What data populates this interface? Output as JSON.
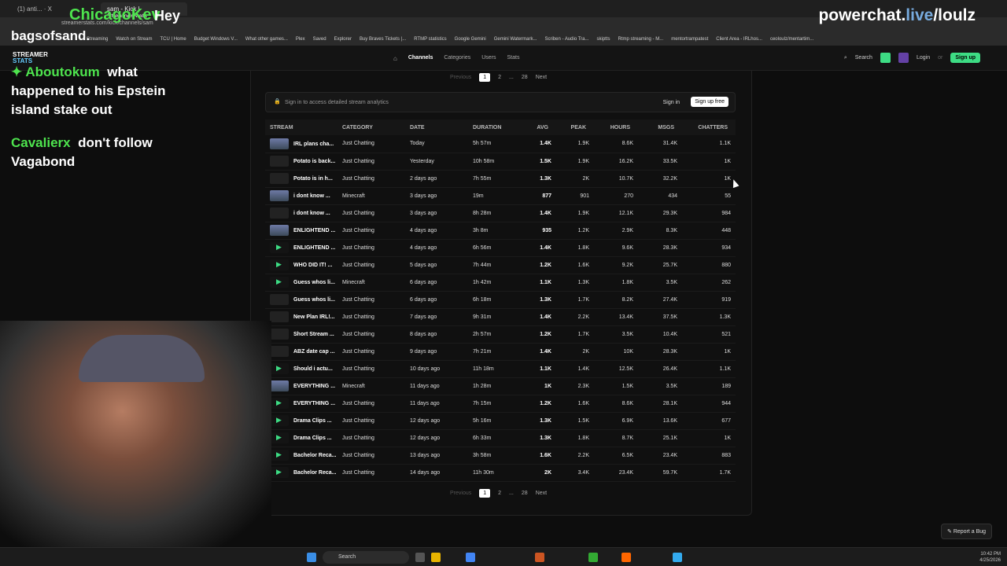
{
  "browser": {
    "tabs": [
      "(1) anti... · X",
      "sam - Kick | StreamerStats"
    ],
    "url": "streamerstats.com/kick/channels/sam",
    "bookmarks": [
      "Streaming",
      "Watch on Stream",
      "TCU | Home",
      "Budget Windows V...",
      "What other games...",
      "Plex",
      "Saved",
      "Explorer",
      "Buy Braves Tickets |...",
      "RTMP statistics",
      "Google Gemini",
      "Gemini Watermark...",
      "Scriben - Audio Tra...",
      "skiptts",
      "Rtmp streaming - M...",
      "mentortrampatest",
      "Client Area - IRLhos...",
      "ceoloulz/mentartim..."
    ]
  },
  "overlay": {
    "title": "ChicagoKev",
    "greet": "Hey",
    "name_line": "bagsofsand.",
    "powerchat_a": "powerchat.",
    "powerchat_b": "live",
    "powerchat_c": "/loulz",
    "chat": [
      {
        "user": "Aboutokum",
        "text1": "what",
        "text2": "happened to his Epstein",
        "text3": "island stake out"
      },
      {
        "user": "Cavalierx",
        "text1": "don't follow",
        "text2": "Vagabond"
      }
    ]
  },
  "site": {
    "logo_top": "STREAMER",
    "logo_bottom": "STATS",
    "nav": [
      "Channels",
      "Categories",
      "Users",
      "Stats"
    ],
    "search": "Search",
    "login": "Login",
    "or": "or",
    "signup": "Sign up"
  },
  "pager": {
    "prev": "Previous",
    "p1": "1",
    "p2": "2",
    "dots": "...",
    "last": "28",
    "next": "Next"
  },
  "signin_bar": {
    "text": "Sign in to access detailed stream analytics",
    "signin": "Sign in",
    "signup": "Sign up free"
  },
  "table": {
    "headers": [
      "STREAM",
      "CATEGORY",
      "DATE",
      "DURATION",
      "AVG",
      "PEAK",
      "HOURS",
      "MSGS",
      "CHATTERS"
    ],
    "rows": [
      {
        "thumb": "img",
        "stream": "IRL plans cha...",
        "category": "Just Chatting",
        "date": "Today",
        "duration": "5h 57m",
        "avg": "1.4K",
        "peak": "1.9K",
        "hours": "8.6K",
        "msgs": "31.4K",
        "chatters": "1.1K"
      },
      {
        "thumb": "dark",
        "stream": "Potato is back...",
        "category": "Just Chatting",
        "date": "Yesterday",
        "duration": "10h 58m",
        "avg": "1.5K",
        "peak": "1.9K",
        "hours": "16.2K",
        "msgs": "33.5K",
        "chatters": "1K"
      },
      {
        "thumb": "dark",
        "stream": "Potato is in h...",
        "category": "Just Chatting",
        "date": "2 days ago",
        "duration": "7h 55m",
        "avg": "1.3K",
        "peak": "2K",
        "hours": "10.7K",
        "msgs": "32.2K",
        "chatters": "1K"
      },
      {
        "thumb": "img",
        "stream": "i dont know ...",
        "category": "Minecraft",
        "date": "3 days ago",
        "duration": "19m",
        "avg": "877",
        "peak": "901",
        "hours": "270",
        "msgs": "434",
        "chatters": "55"
      },
      {
        "thumb": "dark",
        "stream": "i dont know ...",
        "category": "Just Chatting",
        "date": "3 days ago",
        "duration": "8h 28m",
        "avg": "1.4K",
        "peak": "1.9K",
        "hours": "12.1K",
        "msgs": "29.3K",
        "chatters": "984"
      },
      {
        "thumb": "img",
        "stream": "ENLIGHTEND ...",
        "category": "Just Chatting",
        "date": "4 days ago",
        "duration": "3h 8m",
        "avg": "935",
        "peak": "1.2K",
        "hours": "2.9K",
        "msgs": "8.3K",
        "chatters": "448"
      },
      {
        "thumb": "play",
        "stream": "ENLIGHTEND ...",
        "category": "Just Chatting",
        "date": "4 days ago",
        "duration": "6h 56m",
        "avg": "1.4K",
        "peak": "1.8K",
        "hours": "9.6K",
        "msgs": "28.3K",
        "chatters": "934"
      },
      {
        "thumb": "play",
        "stream": "WHO DID IT! ...",
        "category": "Just Chatting",
        "date": "5 days ago",
        "duration": "7h 44m",
        "avg": "1.2K",
        "peak": "1.6K",
        "hours": "9.2K",
        "msgs": "25.7K",
        "chatters": "880"
      },
      {
        "thumb": "play",
        "stream": "Guess whos li...",
        "category": "Minecraft",
        "date": "6 days ago",
        "duration": "1h 42m",
        "avg": "1.1K",
        "peak": "1.3K",
        "hours": "1.8K",
        "msgs": "3.5K",
        "chatters": "262"
      },
      {
        "thumb": "dark",
        "stream": "Guess whos li...",
        "category": "Just Chatting",
        "date": "6 days ago",
        "duration": "6h 18m",
        "avg": "1.3K",
        "peak": "1.7K",
        "hours": "8.2K",
        "msgs": "27.4K",
        "chatters": "919"
      },
      {
        "thumb": "dark",
        "stream": "New Plan IRL!...",
        "category": "Just Chatting",
        "date": "7 days ago",
        "duration": "9h 31m",
        "avg": "1.4K",
        "peak": "2.2K",
        "hours": "13.4K",
        "msgs": "37.5K",
        "chatters": "1.3K"
      },
      {
        "thumb": "dark",
        "stream": "Short Stream ...",
        "category": "Just Chatting",
        "date": "8 days ago",
        "duration": "2h 57m",
        "avg": "1.2K",
        "peak": "1.7K",
        "hours": "3.5K",
        "msgs": "10.4K",
        "chatters": "521"
      },
      {
        "thumb": "dark",
        "stream": "ABZ date cap ...",
        "category": "Just Chatting",
        "date": "9 days ago",
        "duration": "7h 21m",
        "avg": "1.4K",
        "peak": "2K",
        "hours": "10K",
        "msgs": "28.3K",
        "chatters": "1K"
      },
      {
        "thumb": "play",
        "stream": "Should i actu...",
        "category": "Just Chatting",
        "date": "10 days ago",
        "duration": "11h 18m",
        "avg": "1.1K",
        "peak": "1.4K",
        "hours": "12.5K",
        "msgs": "26.4K",
        "chatters": "1.1K"
      },
      {
        "thumb": "img",
        "stream": "EVERYTHING ...",
        "category": "Minecraft",
        "date": "11 days ago",
        "duration": "1h 28m",
        "avg": "1K",
        "peak": "2.3K",
        "hours": "1.5K",
        "msgs": "3.5K",
        "chatters": "189"
      },
      {
        "thumb": "play",
        "stream": "EVERYTHING ...",
        "category": "Just Chatting",
        "date": "11 days ago",
        "duration": "7h 15m",
        "avg": "1.2K",
        "peak": "1.6K",
        "hours": "8.6K",
        "msgs": "28.1K",
        "chatters": "944"
      },
      {
        "thumb": "play",
        "stream": "Drama Clips ...",
        "category": "Just Chatting",
        "date": "12 days ago",
        "duration": "5h 16m",
        "avg": "1.3K",
        "peak": "1.5K",
        "hours": "6.9K",
        "msgs": "13.6K",
        "chatters": "677"
      },
      {
        "thumb": "play",
        "stream": "Drama Clips ...",
        "category": "Just Chatting",
        "date": "12 days ago",
        "duration": "6h 33m",
        "avg": "1.3K",
        "peak": "1.8K",
        "hours": "8.7K",
        "msgs": "25.1K",
        "chatters": "1K"
      },
      {
        "thumb": "play",
        "stream": "Bachelor Reca...",
        "category": "Just Chatting",
        "date": "13 days ago",
        "duration": "3h 58m",
        "avg": "1.6K",
        "peak": "2.2K",
        "hours": "6.5K",
        "msgs": "23.4K",
        "chatters": "883"
      },
      {
        "thumb": "play",
        "stream": "Bachelor Reca...",
        "category": "Just Chatting",
        "date": "14 days ago",
        "duration": "11h 30m",
        "avg": "2K",
        "peak": "3.4K",
        "hours": "23.4K",
        "msgs": "59.7K",
        "chatters": "1.7K"
      }
    ]
  },
  "report_bug": "Report a Bug",
  "taskbar": {
    "search": "Search",
    "time": "10:42 PM",
    "date": "4/25/2026"
  },
  "colors": {
    "accent": "#3ddc84",
    "chat_name": "#4ee44e"
  }
}
